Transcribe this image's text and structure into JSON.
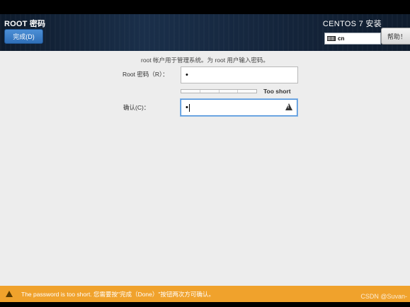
{
  "header": {
    "spoke_title": "ROOT 密码",
    "done_button": "完成(D)",
    "product_title": "CENTOS 7 安装",
    "keyboard_layout": "cn",
    "help_button": "帮助！"
  },
  "form": {
    "description": "root 帐户用于管理系统。为 root 用户输入密码。",
    "password_label": "Root 密码（R）：",
    "password_value": "•",
    "strength_label": "Too short",
    "confirm_label": "确认(C)：",
    "confirm_value": "•"
  },
  "statusbar": {
    "message": "The password is too short. 您需要按\"完成（Done）\"按钮两次方可确认。"
  },
  "watermark": "CSDN @Suvan-",
  "colors": {
    "statusbar": "#f0a22c",
    "done_button": "#3a7cc6",
    "focus_border": "#4a90d9"
  }
}
